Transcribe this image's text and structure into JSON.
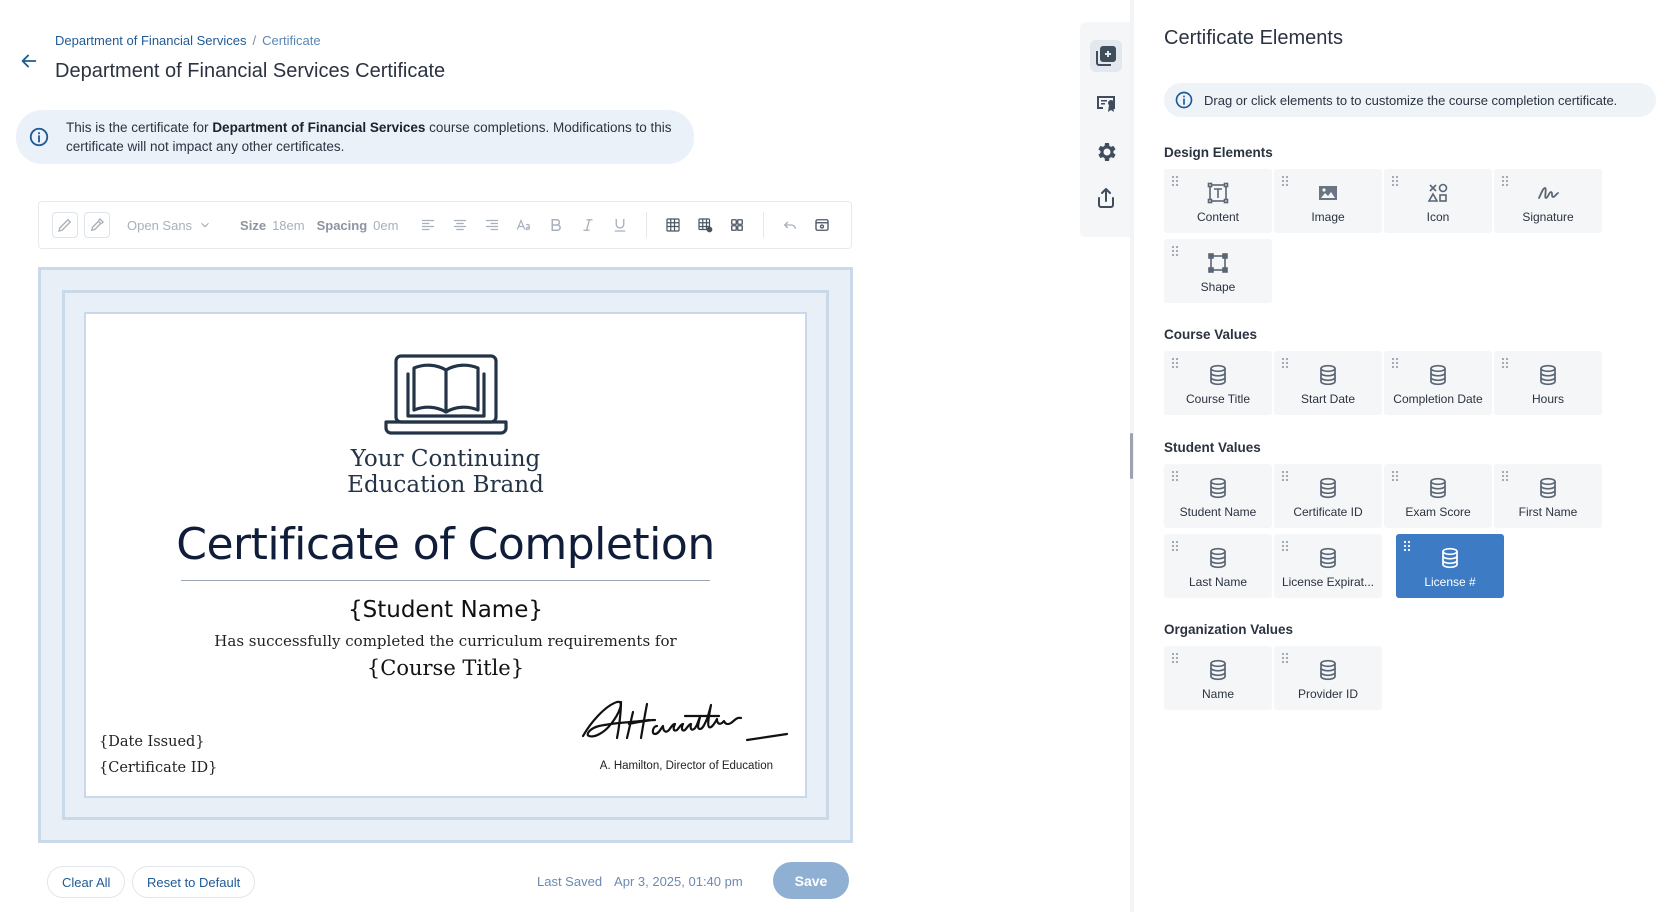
{
  "breadcrumb": {
    "parent": "Department of Financial Services",
    "separator": "/",
    "current": "Certificate"
  },
  "page_title": "Department of Financial Services Certificate",
  "info_banner": {
    "prefix": "This is the certificate for ",
    "bold": "Department of Financial Services",
    "suffix_line1": " course completions. Modifications to this",
    "line2": "certificate will not impact any other certificates."
  },
  "toolbar": {
    "font": "Open Sans",
    "size_label": "Size",
    "size_value": "18em",
    "spacing_label": "Spacing",
    "spacing_value": "0em"
  },
  "certificate": {
    "brand_line1": "Your Continuing",
    "brand_line2": "Education Brand",
    "title": "Certificate of Completion",
    "student_name": "{Student Name}",
    "completed_text": "Has successfully completed the curriculum requirements for",
    "course_title": "{Course Title}",
    "date_issued": "{Date Issued}",
    "certificate_id": "{Certificate ID}",
    "signature_caption": "A. Hamilton, Director of Education",
    "signature_text": "AHamilton"
  },
  "footer": {
    "clear_all": "Clear All",
    "reset_default": "Reset to Default",
    "last_saved_label": "Last Saved",
    "last_saved_value": "Apr 3, 2025, 01:40 pm",
    "save": "Save"
  },
  "panel": {
    "title": "Certificate Elements",
    "info": "Drag or click elements to to customize the course completion certificate.",
    "sections": {
      "design": "Design Elements",
      "course": "Course Values",
      "student": "Student Values",
      "organization": "Organization Values"
    },
    "design_items": [
      "Content",
      "Image",
      "Icon",
      "Signature",
      "Shape"
    ],
    "course_items": [
      "Course Title",
      "Start Date",
      "Completion Date",
      "Hours"
    ],
    "student_items": [
      "Student Name",
      "Certificate ID",
      "Exam Score",
      "First Name",
      "Last Name",
      "License Expirat...",
      "License #"
    ],
    "organization_items": [
      "Name",
      "Provider ID"
    ]
  },
  "colors": {
    "accent": "#1e5a96",
    "selected_tile": "#3d7bc4",
    "save_button": "#8fb0d3",
    "cert_border": "#c9d9ea"
  }
}
